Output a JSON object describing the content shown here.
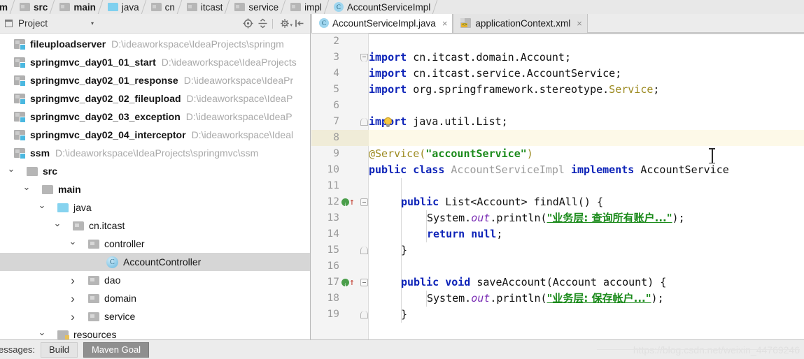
{
  "breadcrumb": {
    "items": [
      {
        "label": "ssm",
        "icon": "folder-module-icon",
        "truncated": true
      },
      {
        "label": "src",
        "icon": "folder-grey-icon"
      },
      {
        "label": "main",
        "icon": "folder-grey-icon"
      },
      {
        "label": "java",
        "icon": "folder-blue-icon"
      },
      {
        "label": "cn",
        "icon": "folder-package-icon"
      },
      {
        "label": "itcast",
        "icon": "folder-package-icon"
      },
      {
        "label": "service",
        "icon": "folder-package-icon"
      },
      {
        "label": "impl",
        "icon": "folder-package-icon"
      },
      {
        "label": "AccountServiceImpl",
        "icon": "java-class-icon"
      }
    ]
  },
  "project_panel": {
    "title": "Project",
    "toolbar_icons": [
      "locate-target-icon",
      "collapse-all-icon",
      "settings-gear-icon",
      "hide-panel-icon"
    ],
    "tree": [
      {
        "indent": 0,
        "arrow": "none",
        "icon": "module-icon",
        "name": "fileuploadserver",
        "path": "D:\\ideaworkspace\\IdeaProjects\\springm",
        "selected": false
      },
      {
        "indent": 0,
        "arrow": "none",
        "icon": "module-icon",
        "name": "springmvc_day01_01_start",
        "path": "D:\\ideaworkspace\\IdeaProjects",
        "selected": false
      },
      {
        "indent": 0,
        "arrow": "none",
        "icon": "module-icon",
        "name": "springmvc_day02_01_response",
        "path": "D:\\ideaworkspace\\IdeaPr",
        "selected": false
      },
      {
        "indent": 0,
        "arrow": "none",
        "icon": "module-icon",
        "name": "springmvc_day02_02_fileupload",
        "path": "D:\\ideaworkspace\\IdeaP",
        "selected": false
      },
      {
        "indent": 0,
        "arrow": "none",
        "icon": "module-icon",
        "name": "springmvc_day02_03_exception",
        "path": "D:\\ideaworkspace\\IdeaP",
        "selected": false
      },
      {
        "indent": 0,
        "arrow": "none",
        "icon": "module-icon",
        "name": "springmvc_day02_04_interceptor",
        "path": "D:\\ideaworkspace\\Ideal",
        "selected": false
      },
      {
        "indent": 0,
        "arrow": "none",
        "icon": "module-icon",
        "name": "ssm",
        "path": "D:\\ideaworkspace\\IdeaProjects\\springmvc\\ssm",
        "selected": false
      },
      {
        "indent": 1,
        "arrow": "down",
        "icon": "folder-icon",
        "name": "src",
        "path": "",
        "selected": false
      },
      {
        "indent": 2,
        "arrow": "down",
        "icon": "folder-icon",
        "name": "main",
        "path": "",
        "selected": false
      },
      {
        "indent": 3,
        "arrow": "down",
        "icon": "folder-blue-icon",
        "name": "java",
        "path": "",
        "selected": false
      },
      {
        "indent": 4,
        "arrow": "down",
        "icon": "package-icon",
        "name": "cn.itcast",
        "path": "",
        "selected": false
      },
      {
        "indent": 5,
        "arrow": "down",
        "icon": "package-icon",
        "name": "controller",
        "path": "",
        "selected": false
      },
      {
        "indent": 6,
        "arrow": "none",
        "icon": "class-icon",
        "name": "AccountController",
        "path": "",
        "selected": true
      },
      {
        "indent": 5,
        "arrow": "right",
        "icon": "package-icon",
        "name": "dao",
        "path": "",
        "selected": false
      },
      {
        "indent": 5,
        "arrow": "right",
        "icon": "package-icon",
        "name": "domain",
        "path": "",
        "selected": false
      },
      {
        "indent": 5,
        "arrow": "right",
        "icon": "package-icon",
        "name": "service",
        "path": "",
        "selected": false
      },
      {
        "indent": 3,
        "arrow": "down",
        "icon": "resources-icon",
        "name": "resources",
        "path": "",
        "selected": false
      }
    ]
  },
  "editor": {
    "tabs": [
      {
        "label": "AccountServiceImpl.java",
        "icon": "java-class-icon",
        "active": true,
        "close": "×"
      },
      {
        "label": "applicationContext.xml",
        "icon": "xml-file-icon",
        "active": false,
        "close": "×"
      }
    ],
    "first_visible_line": 2,
    "highlight_line": 8,
    "lines": [
      {
        "n": "2",
        "text": ""
      },
      {
        "n": "3",
        "text": "import cn.itcast.domain.Account;"
      },
      {
        "n": "4",
        "text": "import cn.itcast.service.AccountService;"
      },
      {
        "n": "5",
        "text": "import org.springframework.stereotype.Service;"
      },
      {
        "n": "6",
        "text": ""
      },
      {
        "n": "7",
        "text": "import java.util.List;"
      },
      {
        "n": "8",
        "text": ""
      },
      {
        "n": "9",
        "text": "@Service(\"accountService\")"
      },
      {
        "n": "10",
        "text": "public class AccountServiceImpl implements AccountService"
      },
      {
        "n": "11",
        "text": ""
      },
      {
        "n": "12",
        "text": "    public List<Account> findAll() {"
      },
      {
        "n": "13",
        "text": "        System.out.println(\"业务层: 查询所有账户...\");"
      },
      {
        "n": "14",
        "text": "        return null;"
      },
      {
        "n": "15",
        "text": "    }"
      },
      {
        "n": "16",
        "text": ""
      },
      {
        "n": "17",
        "text": "    public void saveAccount(Account account) {"
      },
      {
        "n": "18",
        "text": "        System.out.println(\"业务层: 保存帐户...\");"
      },
      {
        "n": "19",
        "text": "    }"
      }
    ],
    "tokens": {
      "kw_import": "import",
      "kw_public": "public",
      "kw_class": "class",
      "kw_implements": "implements",
      "kw_return": "return",
      "kw_null": "null",
      "kw_void": "void",
      "annotation_service": "@Service",
      "annotation_value": "\"accountService\"",
      "class_name": "AccountServiceImpl",
      "interface_name": "AccountService",
      "import_1": " cn.itcast.domain.Account;",
      "import_2": " cn.itcast.service.AccountService;",
      "import_3a": " org.springframework.stereotype.",
      "import_3b": "Service",
      "import_3c": ";",
      "import_4": " java.util.List;",
      "method_findall": " List<Account> findAll() {",
      "println_head": "System.",
      "println_out": "out",
      "println_tail": ".println(",
      "string_findall": "\"业务层: 查询所有账户...\"",
      "string_save": "\"业务层: 保存帐户...\"",
      "println_close": ");",
      "method_save": " saveAccount(Account account) {",
      "brace_close": "}",
      "gutter_markers": [
        "implements-interface-marker"
      ]
    }
  },
  "bottom_bar": {
    "label": "essages:",
    "tabs": [
      {
        "label": "Build",
        "active": false
      },
      {
        "label": "Maven Goal",
        "active": true
      }
    ],
    "watermark": "https://blog.csdn.net/weixin_44769246"
  },
  "colors": {
    "keyword": "#0d23b8",
    "string": "#1a8a1a",
    "annotation": "#9c8a20",
    "field": "#7b2fb5",
    "selection": "#d6d6d6",
    "current_line": "#fdf9e8",
    "panel_bg": "#ececec",
    "module_badge": "#4bb8e0"
  }
}
